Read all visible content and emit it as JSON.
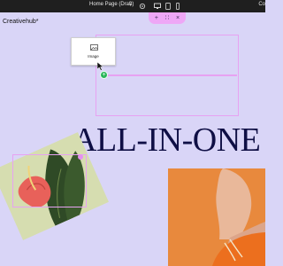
{
  "topbar": {
    "page_selector": "Home Page (Draft)",
    "right_label": "Co"
  },
  "site": {
    "name": "Creativehub*"
  },
  "selection_toolbar": {
    "add_symbol": "+",
    "drag_symbol": "∷",
    "close_symbol": "×"
  },
  "drag_card": {
    "label": "Image"
  },
  "drop_indicator": {
    "symbol": "+"
  },
  "hero": {
    "headline": "ALL-IN-ONE"
  },
  "colors": {
    "canvas": "#d9d5f7",
    "selection": "#e7a2f2",
    "drop": "#28b559",
    "headline": "#0f0f45",
    "photo_bg": "#e78a3e"
  },
  "icons": [
    "chevron-down-icon",
    "settings-icon",
    "desktop-icon",
    "tablet-icon",
    "mobile-icon",
    "image-icon",
    "cursor-icon"
  ]
}
